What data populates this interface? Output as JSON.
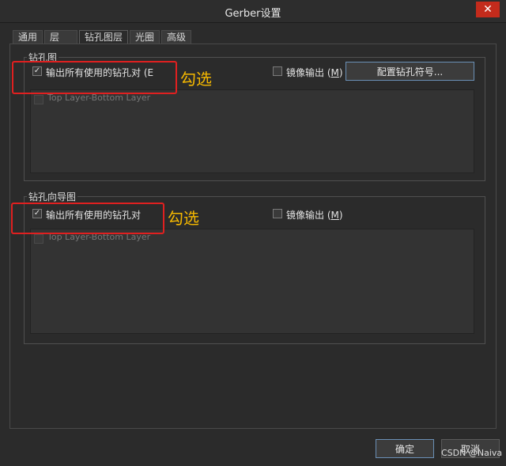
{
  "window": {
    "title": "Gerber设置",
    "close_glyph": "✕"
  },
  "tabs": [
    {
      "label": "通用"
    },
    {
      "label": "层"
    },
    {
      "label": "钻孔图层"
    },
    {
      "label": "光圈"
    },
    {
      "label": "高级"
    }
  ],
  "drill_drawing": {
    "group_label": "钻孔图",
    "plot_all_used_pairs": {
      "label": "输出所有使用的钻孔对 (E",
      "checked": true,
      "check_glyph": "✓"
    },
    "mirror_output": {
      "label": "镜像输出 (",
      "key": "M",
      "suffix": ")",
      "checked": false
    },
    "config_button": "配置钻孔符号...",
    "list_items": [
      {
        "label": "Top Layer-Bottom Layer"
      }
    ]
  },
  "drill_guide": {
    "group_label": "钻孔向导图",
    "plot_all_used_pairs": {
      "label": "输出所有使用的钻孔对",
      "checked": true,
      "check_glyph": "✓"
    },
    "mirror_output": {
      "label": "镜像输出 (",
      "key": "M",
      "suffix": ")",
      "checked": false
    },
    "list_items": [
      {
        "label": "Top Layer-Bottom Layer"
      }
    ]
  },
  "annotations": {
    "check_note_1": "勾选",
    "check_note_2": "勾选"
  },
  "footer": {
    "ok": "确定",
    "cancel": "取消"
  },
  "watermark": "CSDN @Naiva",
  "colors": {
    "highlight_box": "#e02020",
    "annotation_text": "#f5b800",
    "close_button": "#c42b1c"
  }
}
